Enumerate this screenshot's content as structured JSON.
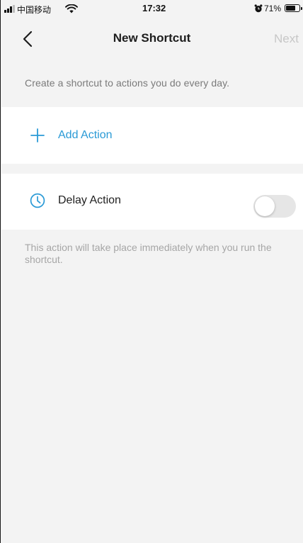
{
  "status_bar": {
    "carrier": "中国移动",
    "time": "17:32",
    "battery_percent": "71%",
    "battery_level": 0.71,
    "icons": [
      "signal-icon",
      "wifi-icon",
      "alarm-icon",
      "battery-icon"
    ]
  },
  "nav": {
    "title": "New Shortcut",
    "next_label": "Next",
    "back_icon": "chevron-left-icon"
  },
  "description": "Create a shortcut to actions you do every day.",
  "add_action": {
    "label": "Add Action",
    "icon": "plus-icon",
    "color": "#2a9ad6"
  },
  "delay_action": {
    "label": "Delay Action",
    "icon": "clock-icon",
    "enabled": false
  },
  "footnote": "This action will take place immediately when you run the shortcut.",
  "colors": {
    "accent": "#2a9ad6",
    "background": "#f3f3f3",
    "disabled_text": "#c7c7c7"
  }
}
